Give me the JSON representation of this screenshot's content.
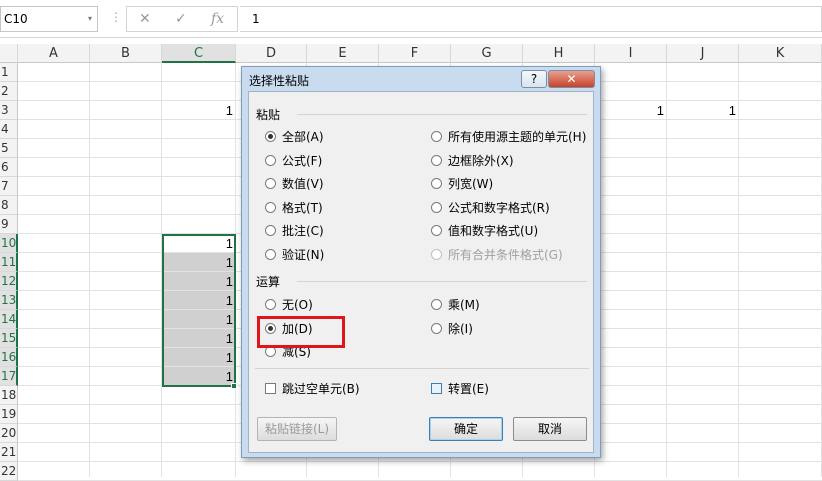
{
  "formula_bar": {
    "name_box": "C10",
    "name_box_dropdown": "▾",
    "separator": "⋮",
    "cancel_symbol": "✕",
    "enter_symbol": "✓",
    "fx_symbol": "fx",
    "value": "1"
  },
  "columns": [
    "A",
    "B",
    "C",
    "D",
    "E",
    "F",
    "G",
    "H",
    "I",
    "J",
    "K"
  ],
  "rows": [
    "1",
    "2",
    "3",
    "4",
    "5",
    "6",
    "7",
    "8",
    "9",
    "10",
    "11",
    "12",
    "13",
    "14",
    "15",
    "16",
    "17",
    "18",
    "19",
    "20",
    "21",
    "22"
  ],
  "cells": {
    "C3": "1",
    "I3": "1",
    "J3": "1",
    "C10": "1",
    "C11": "1",
    "C12": "1",
    "C13": "1",
    "C14": "1",
    "C15": "1",
    "C16": "1",
    "C17": "1"
  },
  "dialog": {
    "title": "选择性粘贴",
    "help_button": "?",
    "close_button": "✕",
    "paste_section": "粘贴",
    "paste_left": [
      "全部(A)",
      "公式(F)",
      "数值(V)",
      "格式(T)",
      "批注(C)",
      "验证(N)"
    ],
    "paste_right": [
      "所有使用源主题的单元(H)",
      "边框除外(X)",
      "列宽(W)",
      "公式和数字格式(R)",
      "值和数字格式(U)",
      "所有合并条件格式(G)"
    ],
    "paste_selected": "全部(A)",
    "operation_section": "运算",
    "op_left": [
      "无(O)",
      "加(D)",
      "减(S)"
    ],
    "op_right": [
      "乘(M)",
      "除(I)"
    ],
    "op_selected": "加(D)",
    "skip_blanks": "跳过空单元(B)",
    "transpose": "转置(E)",
    "paste_link": "粘贴链接(L)",
    "ok": "确定",
    "cancel": "取消"
  },
  "colors": {
    "accent_green": "#217346",
    "highlight_red": "#e0141b",
    "dialog_frame": "#c9dcef"
  }
}
